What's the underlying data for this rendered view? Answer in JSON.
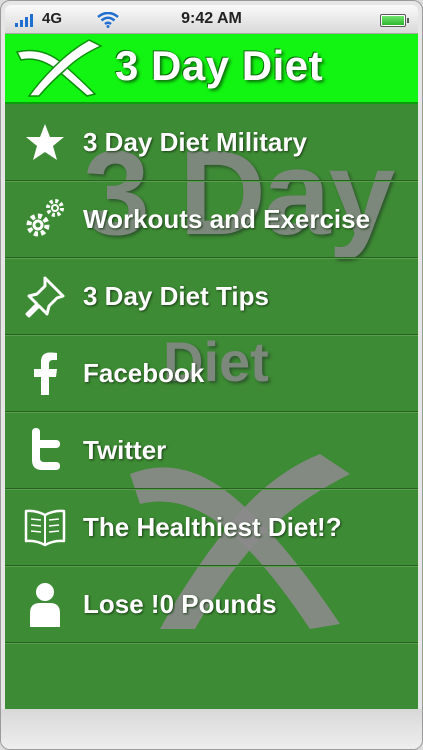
{
  "status_bar": {
    "carrier": "4G",
    "time": "9:42 AM"
  },
  "header": {
    "title": "3 Day Diet",
    "logo_icon": "x-logo-icon"
  },
  "watermark": {
    "line1": "3 Day",
    "line2": "Diet",
    "mark_icon": "x-mark-icon"
  },
  "menu": {
    "items": [
      {
        "label": "3 Day Diet Military",
        "icon": "star-icon"
      },
      {
        "label": "Workouts and Exercise",
        "icon": "gears-icon"
      },
      {
        "label": "3 Day Diet Tips",
        "icon": "pushpin-icon"
      },
      {
        "label": "Facebook",
        "icon": "facebook-icon"
      },
      {
        "label": "Twitter",
        "icon": "twitter-icon"
      },
      {
        "label": "The Healthiest Diet!?",
        "icon": "book-icon"
      },
      {
        "label": "Lose !0 Pounds",
        "icon": "person-icon"
      }
    ]
  },
  "colors": {
    "header_green": "#12f512",
    "content_green": "#3d8b34"
  }
}
